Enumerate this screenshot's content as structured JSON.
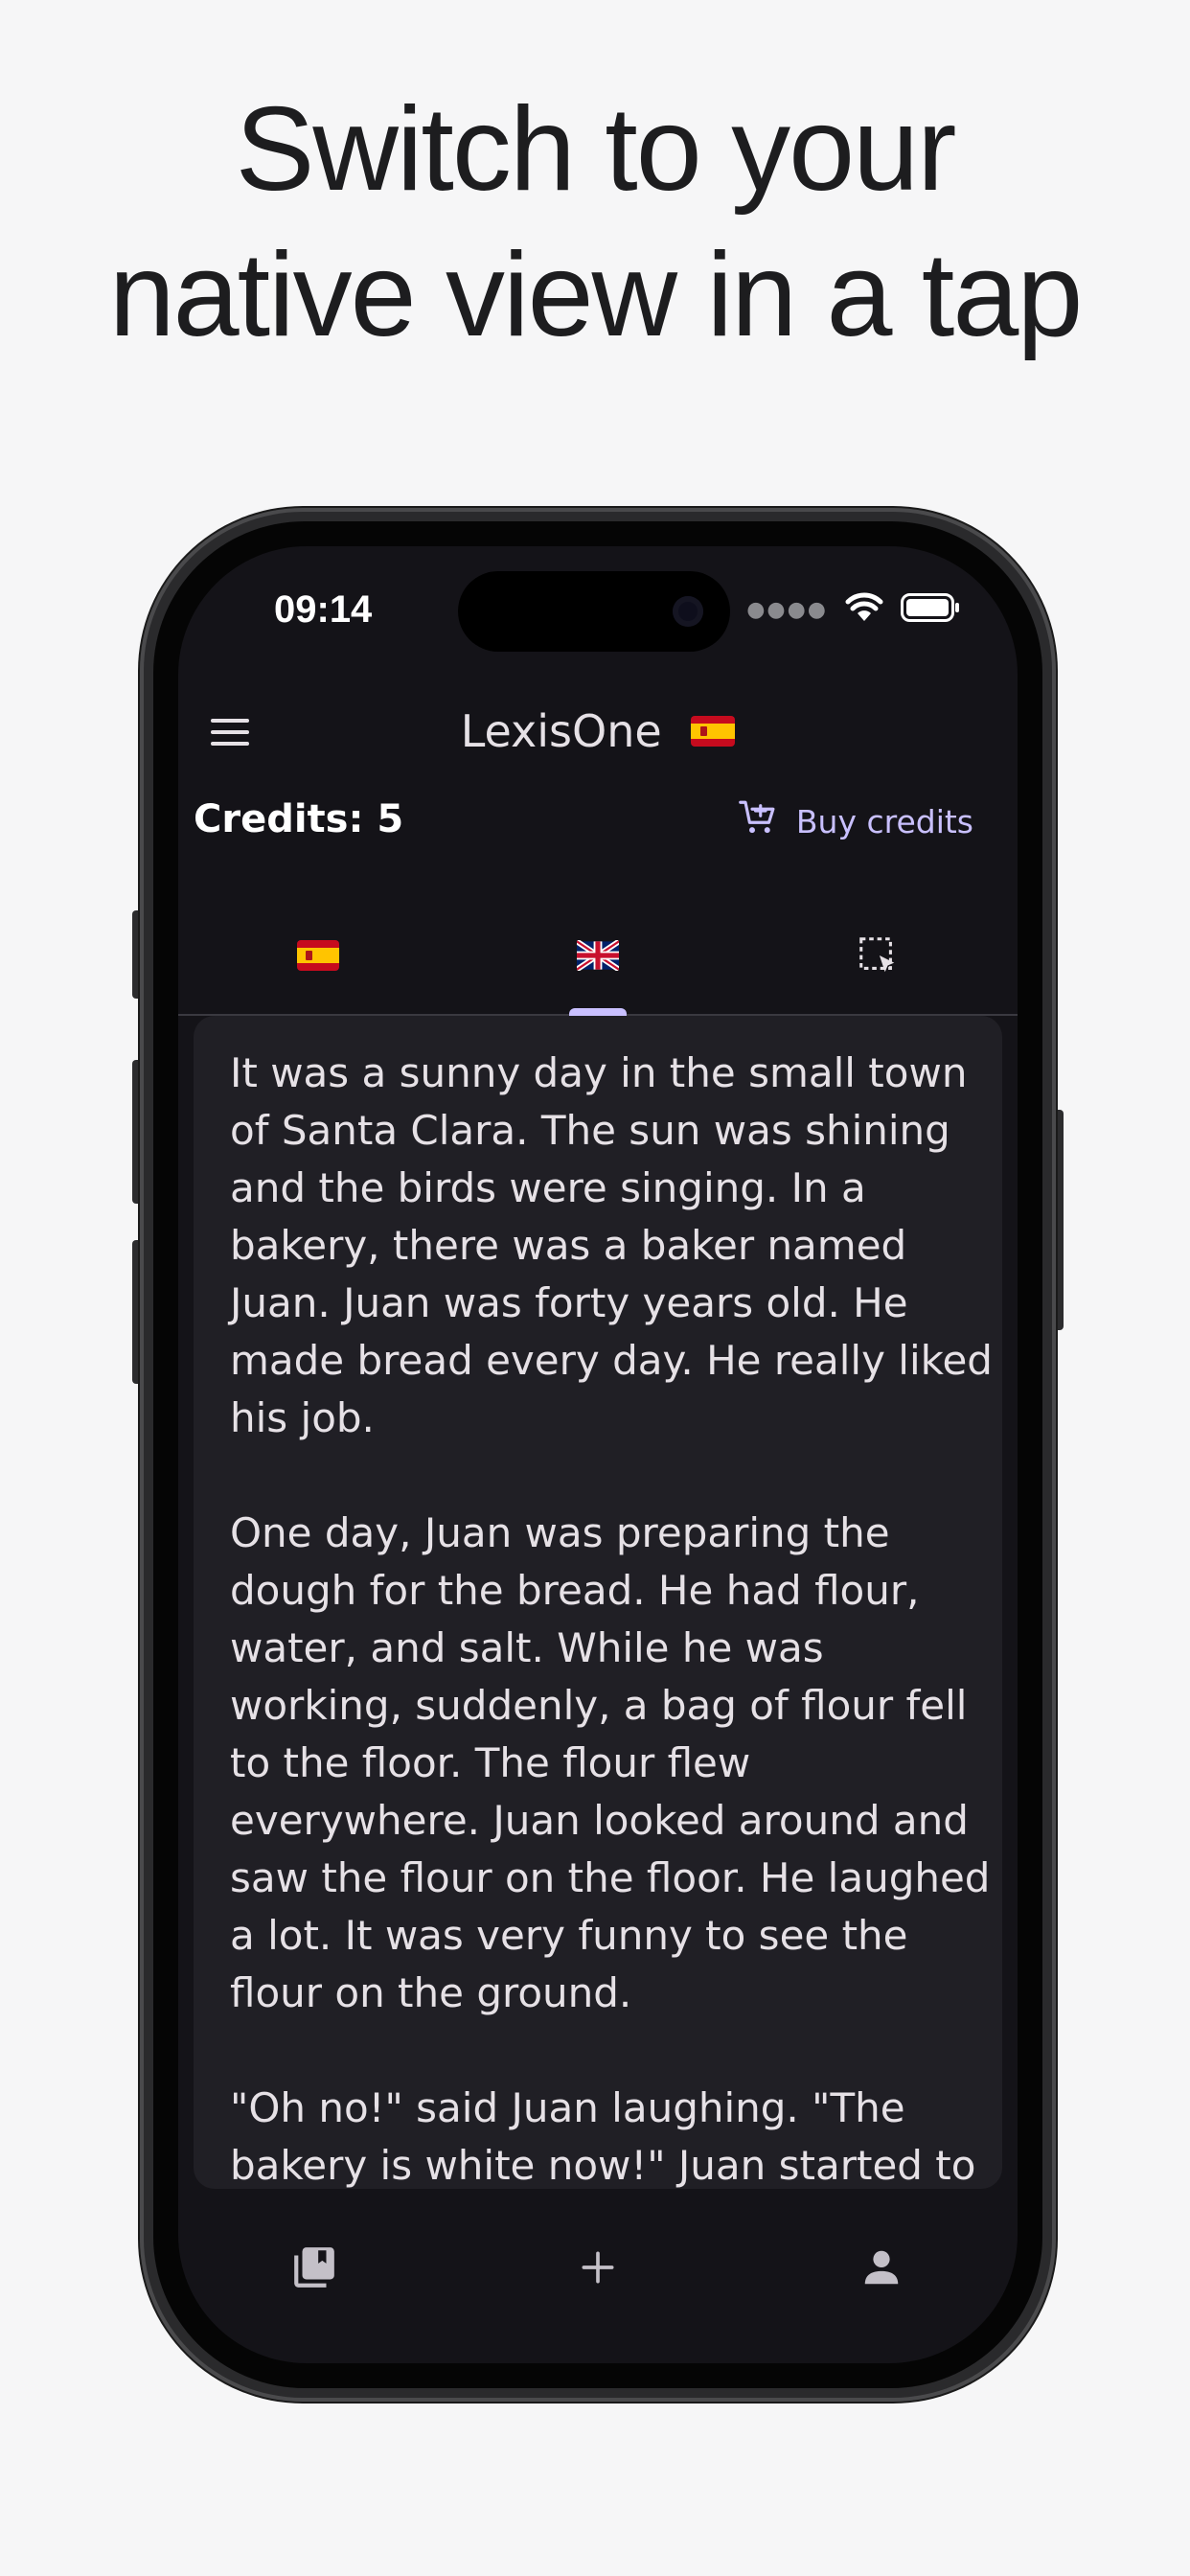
{
  "headline": {
    "line1": "Switch to your",
    "line2": "native view in a tap"
  },
  "status_bar": {
    "time": "09:14",
    "icons": [
      "signal-dots-icon",
      "wifi-icon",
      "battery-icon"
    ]
  },
  "app_bar": {
    "title": "LexisOne",
    "menu_icon": "menu-icon",
    "language_flag": "spain-flag"
  },
  "credits": {
    "label": "Credits: 5",
    "buy_label": "Buy credits",
    "buy_icon": "cart-add-icon"
  },
  "tabs": [
    {
      "icon": "spain-flag",
      "selected": false
    },
    {
      "icon": "uk-flag",
      "selected": true
    },
    {
      "icon": "select-area-icon",
      "selected": false
    }
  ],
  "story": {
    "text": "It was a sunny day in the small town of Santa Clara. The sun was shining and the birds were singing. In a bakery, there was a baker named Juan. Juan was forty years old. He made bread every day. He really liked his job.\n\nOne day, Juan was preparing the dough for the bread. He had flour, water, and salt. While he was working, suddenly, a bag of flour fell to the floor. The flour flew everywhere. Juan looked around and saw the flour on the floor. He laughed a lot. It was very funny to see the flour on the ground.\n\n\"Oh no!\" said Juan laughing. \"The bakery is white now!\" Juan started to clean the flour, but it was hard because he laughed so much. Every"
  },
  "bottom_nav": [
    {
      "icon": "library-icon"
    },
    {
      "icon": "plus-icon"
    },
    {
      "icon": "person-icon"
    }
  ],
  "colors": {
    "background": "#f6f6f7",
    "screen": "#141318",
    "card": "#201f25",
    "accent": "#c9c0ff",
    "text": "#e6e1e6"
  }
}
